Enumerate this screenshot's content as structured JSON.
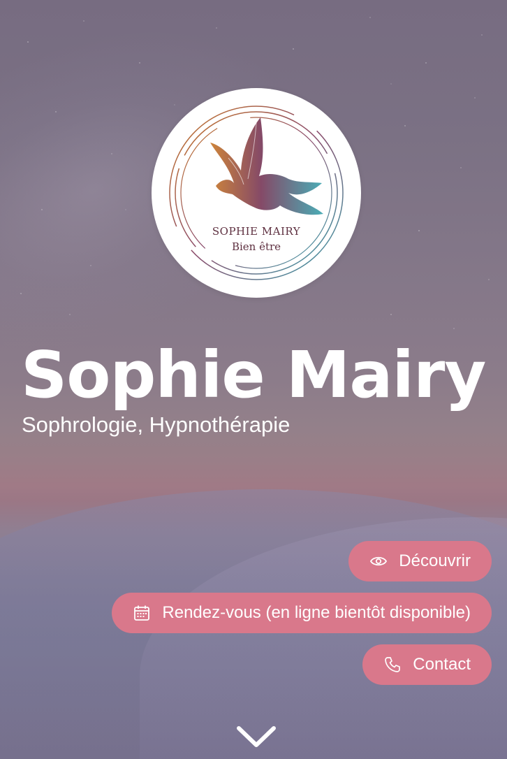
{
  "logo": {
    "name": "SOPHIE MAIRY",
    "tagline": "Bien être"
  },
  "hero": {
    "title": "Sophie Mairy",
    "subtitle": "Sophrologie, Hypnothérapie"
  },
  "buttons": {
    "discover": {
      "label": "Découvrir",
      "icon": "eye-icon"
    },
    "appointment": {
      "label": "Rendez-vous (en ligne bientôt disponible)",
      "icon": "calendar-icon"
    },
    "contact": {
      "label": "Contact",
      "icon": "phone-icon"
    }
  },
  "scroll": {
    "icon": "chevron-down-icon"
  },
  "colors": {
    "button_bg": "#d9788b",
    "text": "#ffffff",
    "logo_text": "#5e3040"
  }
}
